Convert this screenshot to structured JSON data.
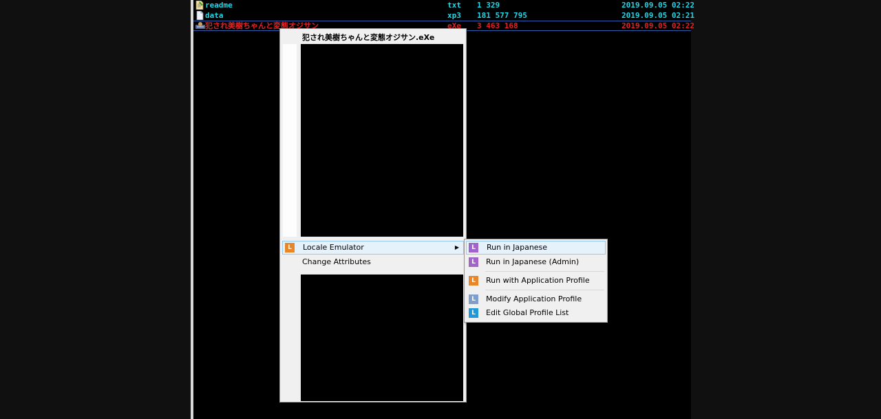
{
  "files": [
    {
      "name": "readme",
      "ext": "txt",
      "size": "1 329",
      "date": "2019.09.05 02:22",
      "icon": "text-file-icon",
      "selected": false
    },
    {
      "name": "data",
      "ext": "xp3",
      "size": "181 577 795",
      "date": "2019.09.05 02:21",
      "icon": "generic-file-icon",
      "selected": false
    },
    {
      "name": "犯され美樹ちゃんと変態オジサン",
      "ext": "eXe",
      "size": "3 463 168",
      "date": "2019.09.05 02:22",
      "icon": "executable-icon",
      "selected": true
    }
  ],
  "context_menu": {
    "title": "犯され美樹ちゃんと変態オジサン.eXe",
    "items": [
      {
        "label": "Locale Emulator",
        "icon": "locale-emulator-icon",
        "icon_color": "#e8862a",
        "has_submenu": true
      },
      {
        "label": "Change Attributes"
      }
    ]
  },
  "submenu": {
    "items": [
      {
        "label": "Run in Japanese",
        "icon_color": "#a264c8"
      },
      {
        "label": "Run in Japanese (Admin)",
        "icon_color": "#a264c8"
      },
      {
        "label": "Run with Application Profile",
        "icon_color": "#e8862a"
      },
      {
        "label": "Modify Application Profile",
        "icon_color": "#7e9fcb"
      },
      {
        "label": "Edit Global Profile List",
        "icon_color": "#1f9ad6"
      }
    ]
  },
  "icon_letter": "L",
  "colors": {
    "file_text": "#22d6e8",
    "file_selected": "#e02222",
    "menu_hover": "#e5f1fb"
  }
}
